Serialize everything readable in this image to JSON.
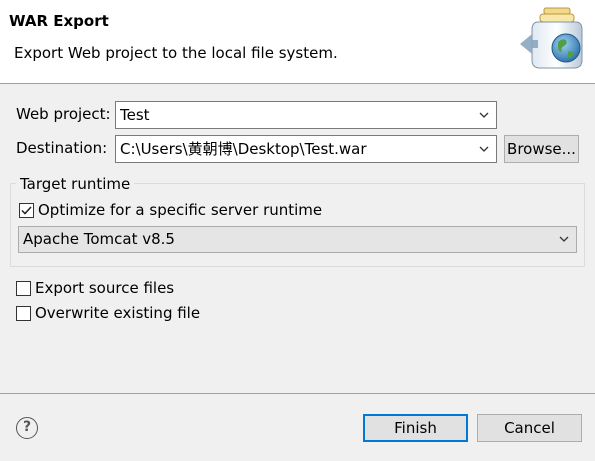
{
  "header": {
    "title": "WAR Export",
    "description": "Export Web project to the local file system.",
    "icon": "export-war-jar-globe-icon"
  },
  "web_project": {
    "label": "Web project:",
    "value": "Test"
  },
  "destination": {
    "label": "Destination:",
    "value": "C:\\Users\\黄朝博\\Desktop\\Test.war",
    "browse_label": "Browse..."
  },
  "target_runtime": {
    "legend": "Target runtime",
    "optimize_label": "Optimize for a specific server runtime",
    "optimize_checked": true,
    "runtime_value": "Apache Tomcat v8.5"
  },
  "options": {
    "export_source_label": "Export source files",
    "export_source_checked": false,
    "overwrite_label": "Overwrite existing file",
    "overwrite_checked": false
  },
  "footer": {
    "help_symbol": "?",
    "finish_label": "Finish",
    "cancel_label": "Cancel"
  },
  "colors": {
    "header_bg": "#ffffff",
    "dialog_bg": "#f0f0f0",
    "default_button_border": "#0078d7"
  }
}
